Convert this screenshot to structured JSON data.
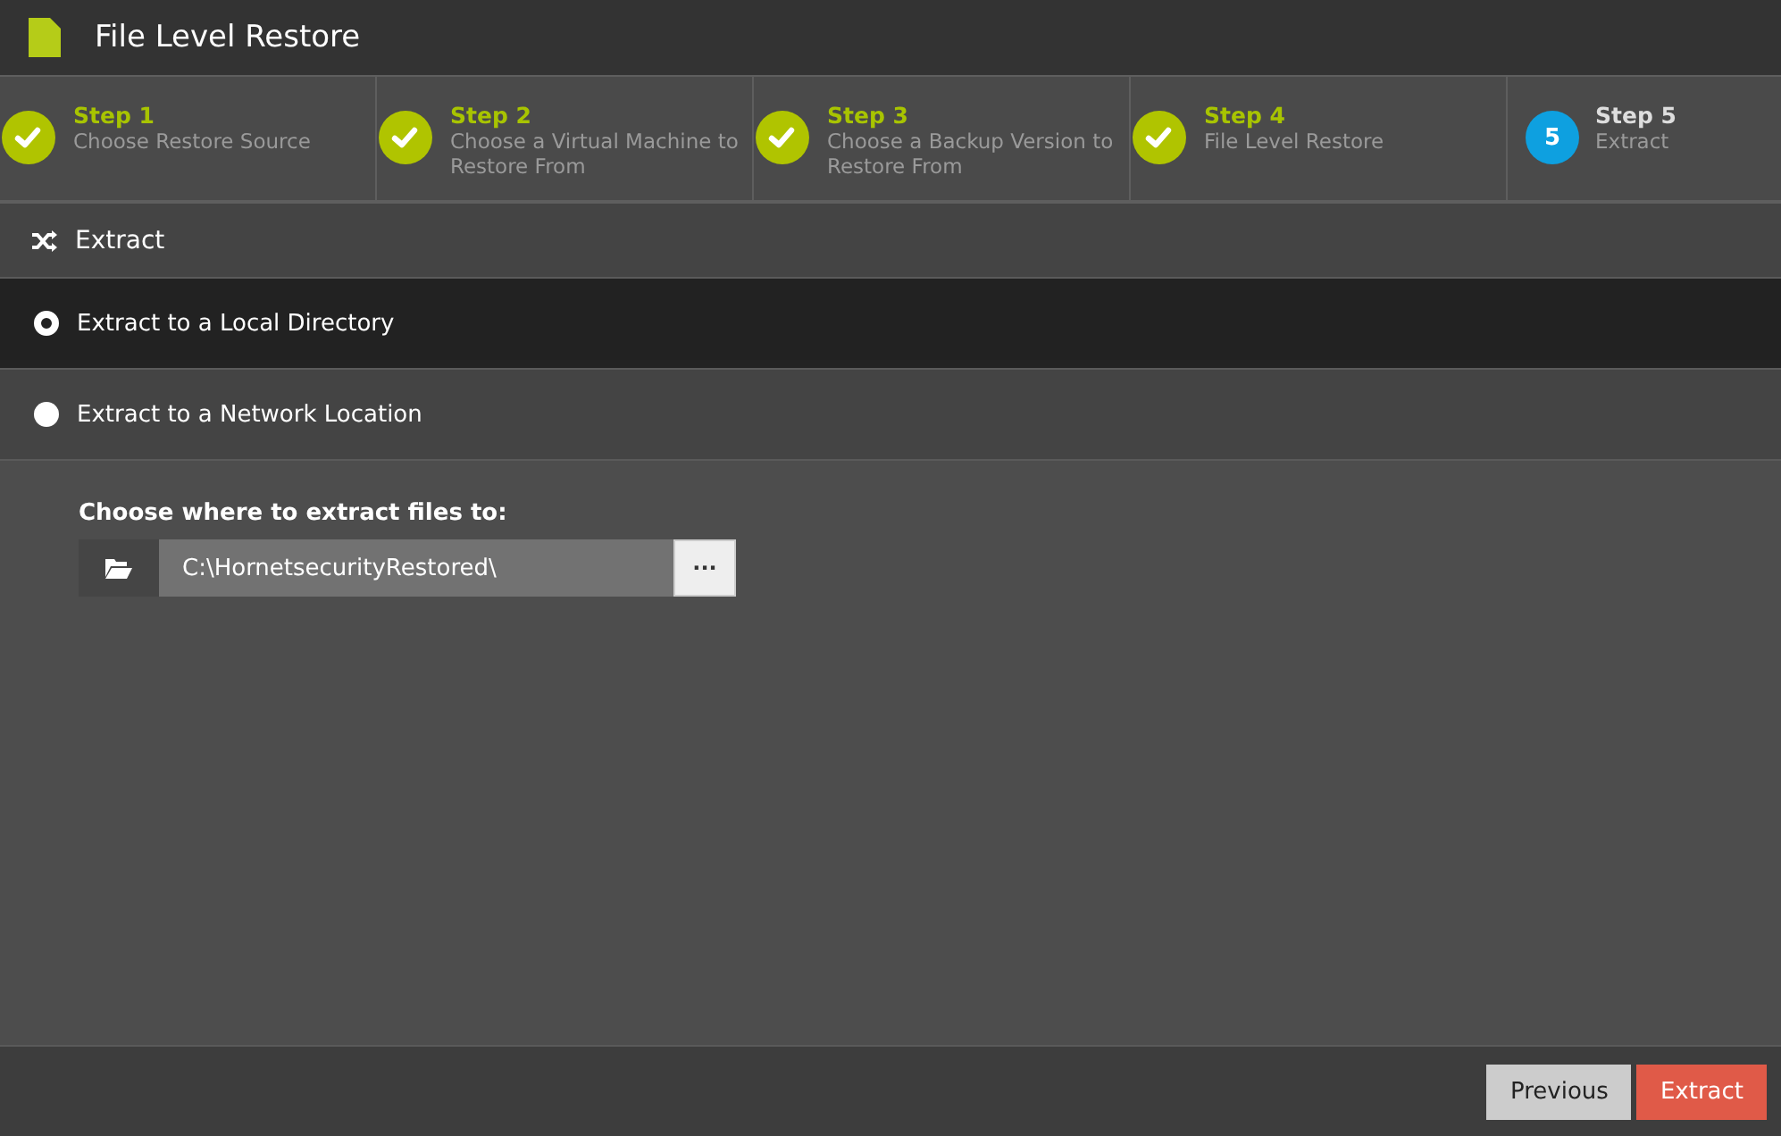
{
  "window": {
    "title": "File Level Restore"
  },
  "steps": [
    {
      "title": "Step 1",
      "subtitle": "Choose Restore Source",
      "kind": "done"
    },
    {
      "title": "Step 2",
      "subtitle": "Choose a Virtual Machine to Restore From",
      "kind": "done"
    },
    {
      "title": "Step 3",
      "subtitle": "Choose a Backup Version to Restore From",
      "kind": "done"
    },
    {
      "title": "Step 4",
      "subtitle": "File Level Restore",
      "kind": "done"
    },
    {
      "title": "Step 5",
      "subtitle": "Extract",
      "kind": "current",
      "number": "5"
    }
  ],
  "section": {
    "title": "Extract"
  },
  "options": [
    {
      "label": "Extract to a Local Directory",
      "selected": true
    },
    {
      "label": "Extract to a Network Location",
      "selected": false
    }
  ],
  "destination": {
    "label": "Choose where to extract files to:",
    "value": "C:\\HornetsecurityRestored\\",
    "browse": "···"
  },
  "buttons": [
    {
      "label": "Previous",
      "kind": "secondary"
    },
    {
      "label": "Extract",
      "kind": "primary"
    }
  ]
}
